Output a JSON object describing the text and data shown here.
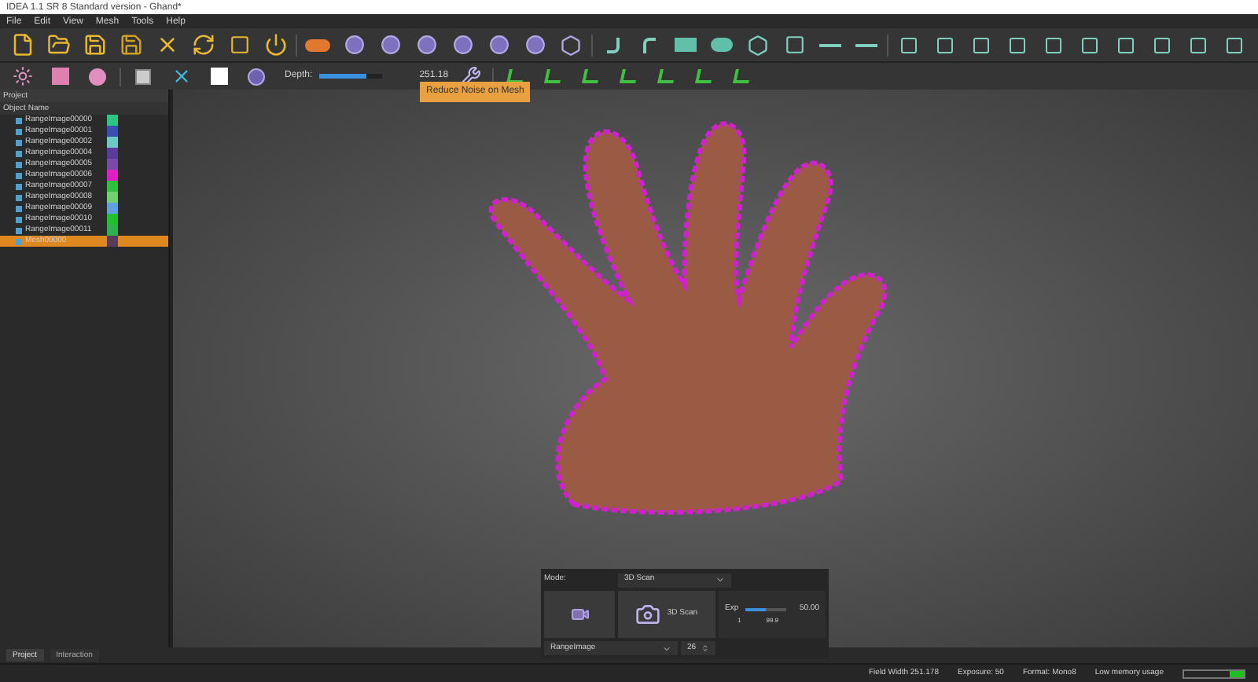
{
  "window": {
    "title": "IDEA 1.1 SR 8 Standard version - Ghand*"
  },
  "menu": [
    "File",
    "Edit",
    "View",
    "Mesh",
    "Tools",
    "Help"
  ],
  "toolbar2": {
    "depth_label": "Depth:",
    "depth_slider": {
      "level": 0.75
    },
    "depth_value": "251.18",
    "tooltip": "Reduce Noise on Mesh"
  },
  "project_panel": {
    "title": "Project",
    "column": "Object Name",
    "items": [
      {
        "name": "RangeImage00000",
        "color": "#2ec486",
        "selected": false
      },
      {
        "name": "RangeImage00001",
        "color": "#3a4fb0",
        "selected": false
      },
      {
        "name": "RangeImage00002",
        "color": "#6ec8c8",
        "selected": false
      },
      {
        "name": "RangeImage00004",
        "color": "#5a3a9a",
        "selected": false
      },
      {
        "name": "RangeImage00005",
        "color": "#7a4aa8",
        "selected": false
      },
      {
        "name": "RangeImage00006",
        "color": "#e020c0",
        "selected": false
      },
      {
        "name": "RangeImage00007",
        "color": "#30c040",
        "selected": false
      },
      {
        "name": "RangeImage00008",
        "color": "#70d070",
        "selected": false
      },
      {
        "name": "RangeImage00009",
        "color": "#60a0e0",
        "selected": false
      },
      {
        "name": "RangeImage00010",
        "color": "#20c030",
        "selected": false
      },
      {
        "name": "RangeImage00011",
        "color": "#30b050",
        "selected": false
      },
      {
        "name": "Mesh00000",
        "color": "#5a3a5a",
        "selected": true
      }
    ]
  },
  "scan_panel": {
    "mode_label": "Mode:",
    "mode_value": "3D Scan",
    "scan_button": "3D Scan",
    "exp_label": "Exp",
    "exp_slider": {
      "level": 0.5
    },
    "exp_value": "50.00",
    "exp_min": "1",
    "exp_max": "99.9",
    "image_type": "RangeImage",
    "count": "26"
  },
  "bottom_tabs": [
    {
      "label": "Project",
      "selected": true
    },
    {
      "label": "Interaction",
      "selected": false
    }
  ],
  "status_bar": {
    "field_width": "Field Width 251.178",
    "exposure": "Exposure: 50",
    "format": "Format: Mono8",
    "memory": "Low memory usage",
    "memory_bar": {
      "level": 0.25
    }
  }
}
